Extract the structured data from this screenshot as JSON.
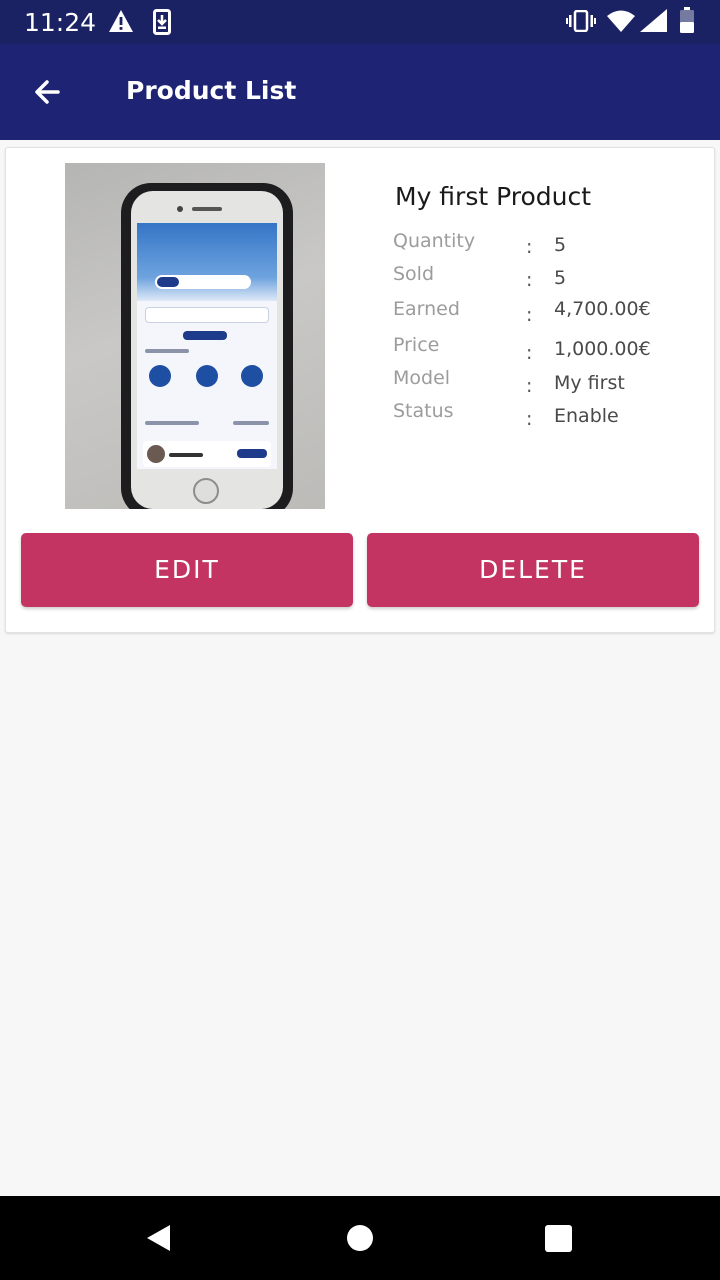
{
  "status_bar": {
    "time": "11:24",
    "icons": [
      "warning-icon",
      "download-icon",
      "vibrate-icon",
      "wifi-icon",
      "signal-icon",
      "battery-icon"
    ]
  },
  "app_bar": {
    "title": "Product List",
    "back_icon": "arrow-left-icon",
    "color": "#1e2473"
  },
  "product": {
    "name": "My first Product",
    "image_description_icon": "product-photo",
    "fields": [
      {
        "label": "Quantity",
        "value": "5"
      },
      {
        "label": "Sold",
        "value": "5"
      },
      {
        "label": "Earned",
        "value": "4,700.00€"
      },
      {
        "label": "Price",
        "value": "1,000.00€"
      },
      {
        "label": "Model",
        "value": "My first"
      },
      {
        "label": "Status",
        "value": "Enable"
      }
    ],
    "separator": ":"
  },
  "actions": {
    "edit_label": "EDIT",
    "delete_label": "DELETE",
    "button_color": "#c33462"
  },
  "nav_bar": {
    "icons": [
      "back-triangle-icon",
      "home-circle-icon",
      "recents-square-icon"
    ]
  }
}
